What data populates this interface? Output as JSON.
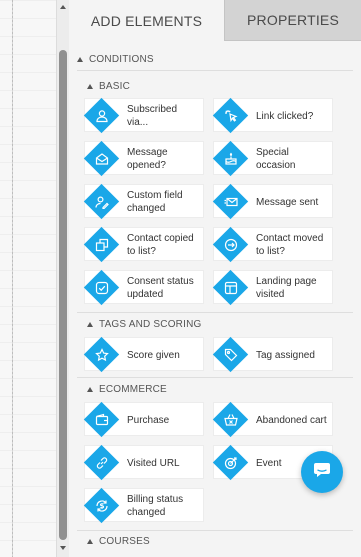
{
  "tabs": {
    "add_elements": "ADD ELEMENTS",
    "properties": "PROPERTIES"
  },
  "conditions_label": "CONDITIONS",
  "sections": {
    "basic": "BASIC",
    "tags_scoring": "TAGS AND SCORING",
    "ecommerce": "ECOMMERCE",
    "courses": "COURSES"
  },
  "elements": {
    "subscribed_via": "Subscribed via...",
    "link_clicked": "Link clicked?",
    "message_opened": "Message opened?",
    "special_occasion": "Special occasion",
    "custom_field_changed": "Custom field changed",
    "message_sent": "Message sent",
    "contact_copied": "Contact copied to list?",
    "contact_moved": "Contact moved to list?",
    "consent_status_updated": "Consent status updated",
    "landing_page_visited": "Landing page visited",
    "score_given": "Score given",
    "tag_assigned": "Tag assigned",
    "purchase": "Purchase",
    "abandoned_cart": "Abandoned cart",
    "visited_url": "Visited URL",
    "event": "Event",
    "billing_status_changed": "Billing status changed"
  },
  "colors": {
    "accent": "#1aa7e8",
    "panel_bg": "#f4f4f4",
    "inactive_tab": "#d3d3d3"
  }
}
